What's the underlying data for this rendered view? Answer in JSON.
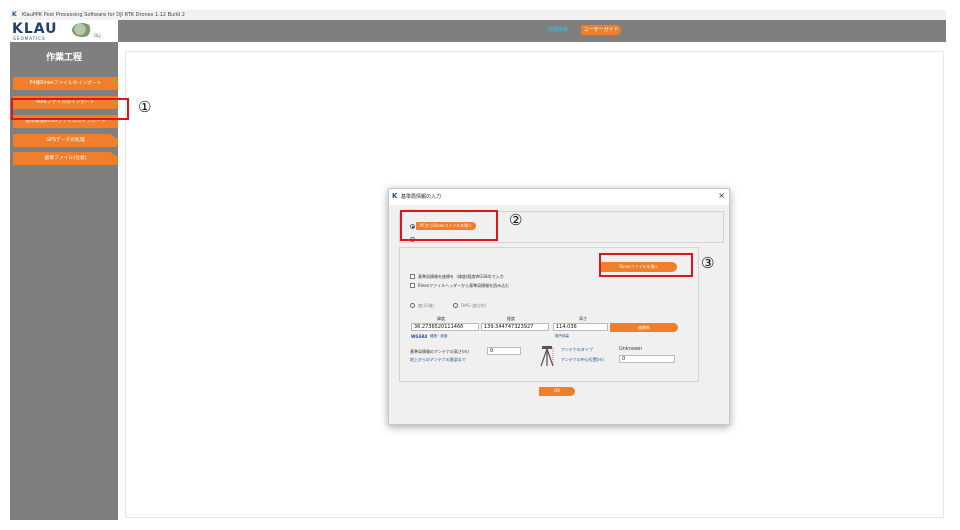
{
  "window": {
    "title": "KlauPPK Post Processing Software for DJI RTK Drones 1.12 Build 2",
    "icon": "k-logo-icon"
  },
  "logo": {
    "brand": "KLAU",
    "sub": "GEOMATICS",
    "partner": "GLJ"
  },
  "sidebar": {
    "title": "作業工程",
    "steps": [
      {
        "label": "P4側Rinexファイルのインポート",
        "done": true
      },
      {
        "label": "MRKファイルのインポート",
        "done": true
      },
      {
        "label": "基準局側Rinexファイルのインポート",
        "done": false
      },
      {
        "label": "GPSデータの処理",
        "done": false
      },
      {
        "label": "画像ファイル(任意)",
        "done": false
      }
    ]
  },
  "topbar": {
    "details_label": "詳細情報",
    "guide_button": "ユーザーガイド"
  },
  "annotations": {
    "marker1": "①",
    "marker2": "②",
    "marker3": "③"
  },
  "dialog": {
    "title": "基準局情報の入力",
    "close": "×",
    "option_pc": "PCからRinexファイルを開く",
    "open_rinex_button": "Rinexファイルを開く",
    "check_manual": "基準局情報を座標を（緯度/経度WGS84)で入力",
    "check_header": "Rinexファイルヘッダーから基準局情報を読み込む",
    "radio_deg": "度(10進)",
    "radio_dms": "DMS (度分秒)",
    "col_lat": "緯度",
    "col_lon": "経度",
    "col_height": "高さ",
    "lat_value": "36.2736520111466",
    "lon_value": "139.344747323927",
    "height_value": "114.036",
    "coord_button": "座標系",
    "wgs84_label": "WGS84",
    "wgs84_sub": "緯度・経度",
    "height_sub": "楕円体高",
    "antenna_height_label": "基準局情報のアンテナの高さ(m)",
    "antenna_height_value": "0",
    "ground_to_antenna": "地上からのアンテナの基部まで",
    "antenna_type_label": "アンテナのタイプ",
    "antenna_type_value": "Unknown",
    "antenna_center_label": "アンテナの中心位置(m)",
    "antenna_center_value": "0",
    "ok_button": "OK"
  },
  "colors": {
    "accent": "#f07e2b",
    "sidebar_bg": "#7f7f7f",
    "highlight": "#e0141c",
    "brand": "#1f3f6e",
    "check": "#7cc242"
  }
}
